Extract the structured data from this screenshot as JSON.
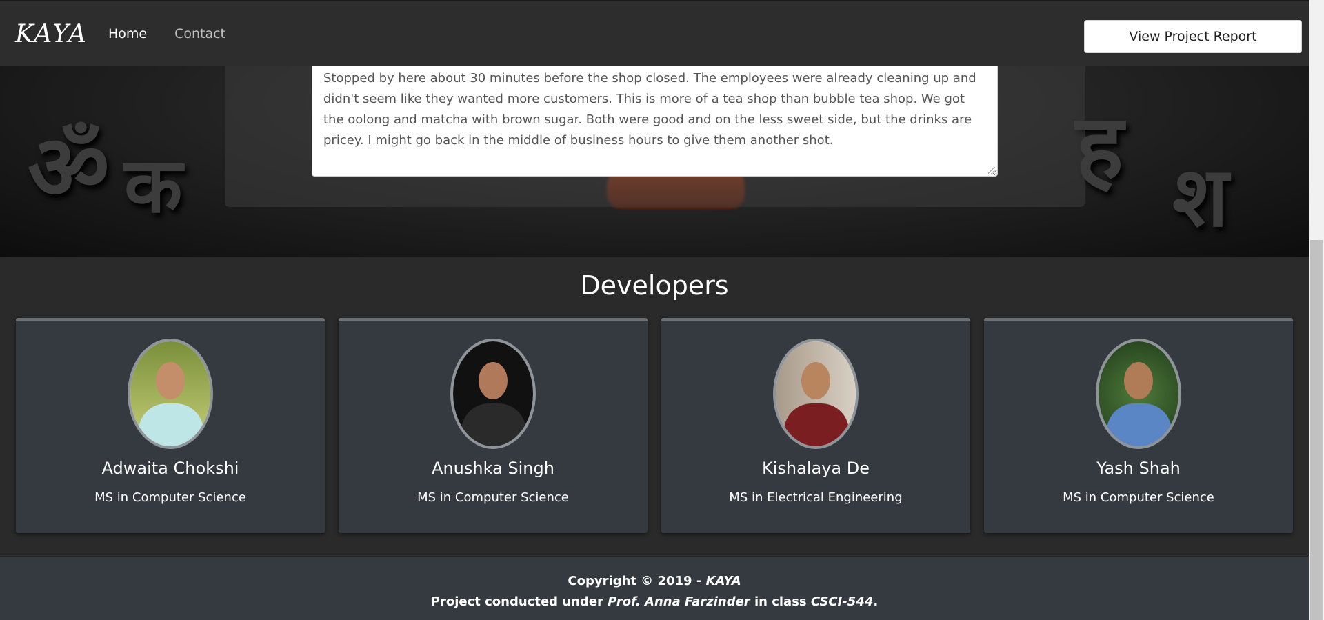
{
  "navbar": {
    "brand": "KAYA",
    "links": [
      {
        "label": "Home"
      },
      {
        "label": "Contact"
      }
    ],
    "report_button": "View Project Report"
  },
  "review": {
    "text": "Stopped by here about 30 minutes before the shop closed. The employees were already cleaning up and didn't seem like they wanted more customers. This is more of a tea shop than bubble tea shop. We got the oolong and matcha with brown sugar. Both were good and on the less sweet side, but the drinks are pricey. I might go back in the middle of business hours to give them another shot."
  },
  "developers": {
    "title": "Developers",
    "people": [
      {
        "name": "Adwaita Chokshi",
        "degree": "MS in Computer Science"
      },
      {
        "name": "Anushka Singh",
        "degree": "MS in Computer Science"
      },
      {
        "name": "Kishalaya De",
        "degree": "MS in Electrical Engineering"
      },
      {
        "name": "Yash Shah",
        "degree": "MS in Computer Science"
      }
    ]
  },
  "footer": {
    "copyright_prefix": "Copyright © 2019 - ",
    "copyright_brand": "KAYA",
    "project_prefix": "Project conducted under ",
    "professor": "Prof. Anna Farzinder",
    "class_prefix": " in class ",
    "class_code": "CSCI-544",
    "period": "."
  },
  "colors": {
    "navbar_bg": "#2d2d2d",
    "card_bg": "#343a40",
    "footer_bg": "#343a40"
  }
}
